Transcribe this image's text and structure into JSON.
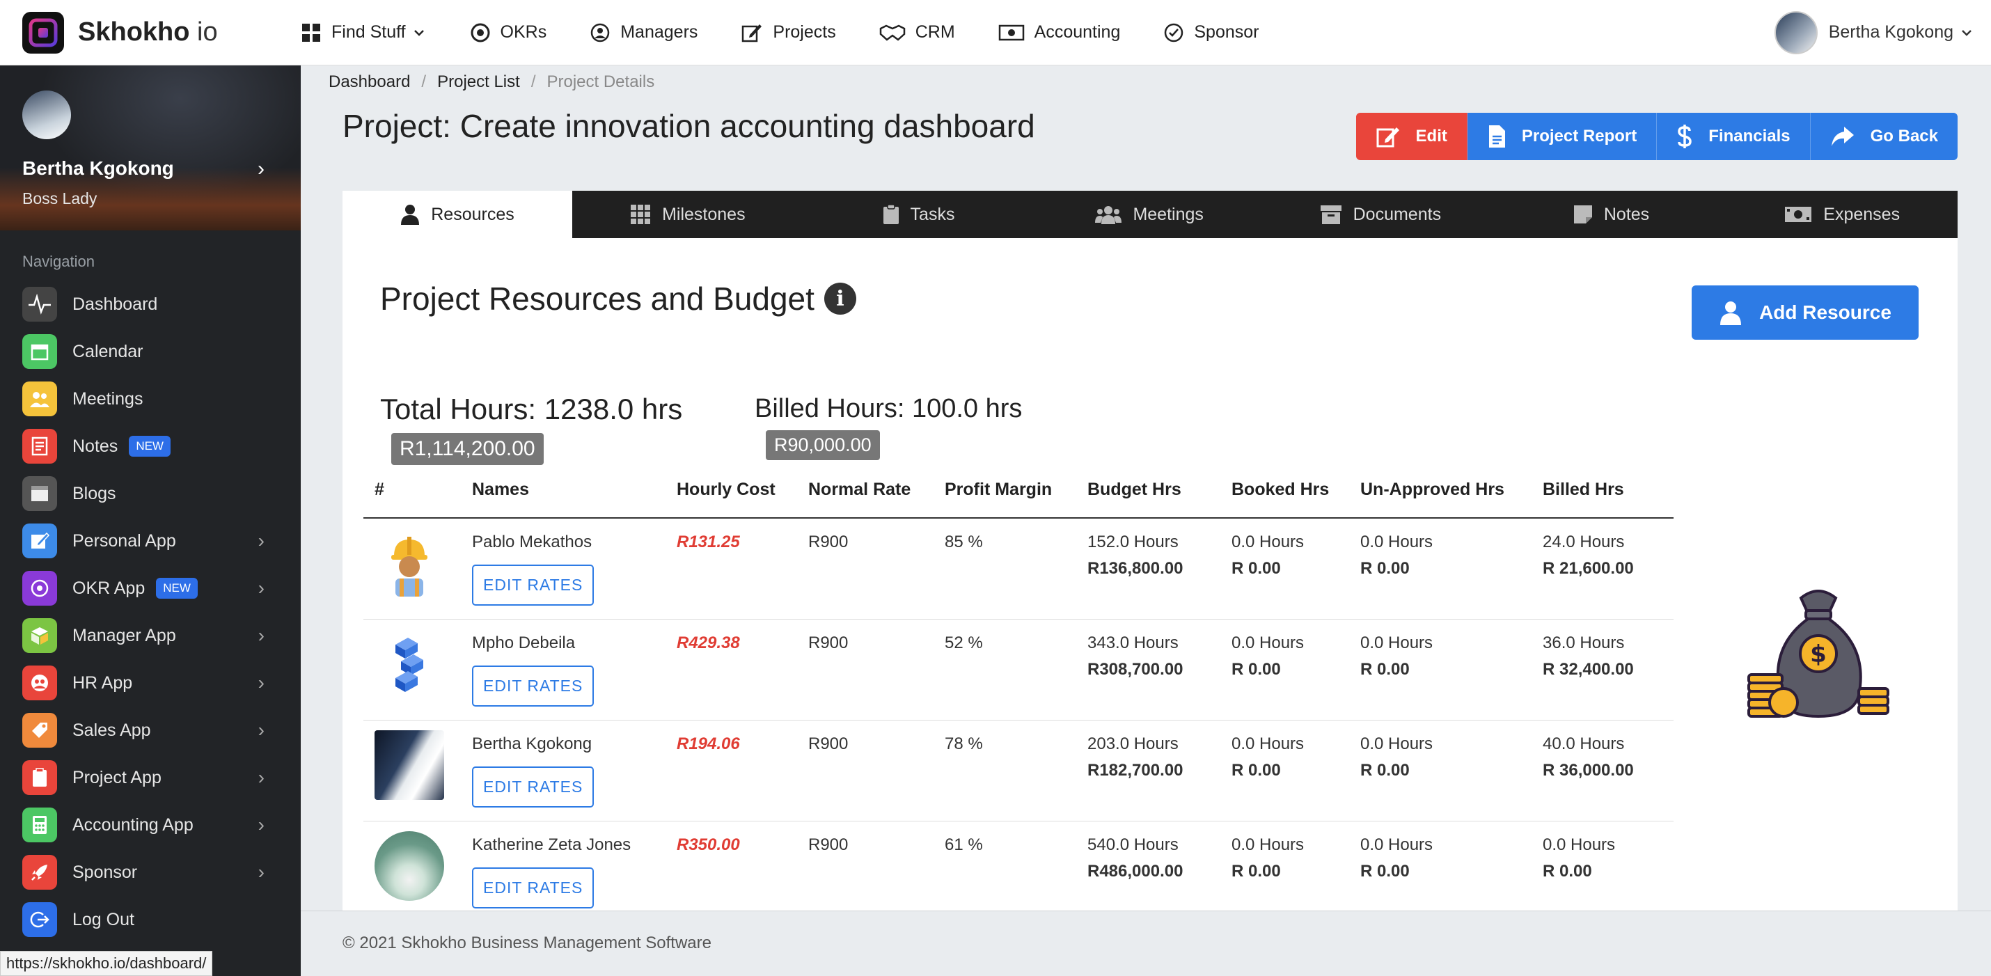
{
  "brand": {
    "name": "Skhokho",
    "suffix": " io"
  },
  "topnav": [
    {
      "label": "Find Stuff",
      "icon": "grid-icon"
    },
    {
      "label": "OKRs",
      "icon": "target-icon"
    },
    {
      "label": "Managers",
      "icon": "user-circle-icon"
    },
    {
      "label": "Projects",
      "icon": "edit-icon"
    },
    {
      "label": "CRM",
      "icon": "handshake-icon"
    },
    {
      "label": "Accounting",
      "icon": "money-icon"
    },
    {
      "label": "Sponsor",
      "icon": "check-circle-icon"
    }
  ],
  "user": {
    "name": "Bertha Kgokong",
    "role": "Boss Lady"
  },
  "sidebar": {
    "title": "Navigation",
    "items": [
      {
        "label": "Dashboard",
        "color": "#444444",
        "badge": "",
        "chevron": false
      },
      {
        "label": "Calendar",
        "color": "#4cc764",
        "badge": "",
        "chevron": false
      },
      {
        "label": "Meetings",
        "color": "#f5c33b",
        "badge": "",
        "chevron": false
      },
      {
        "label": "Notes",
        "color": "#e9453b",
        "badge": "NEW",
        "chevron": false
      },
      {
        "label": "Blogs",
        "color": "#555555",
        "badge": "",
        "chevron": false
      },
      {
        "label": "Personal App",
        "color": "#3d8be8",
        "badge": "",
        "chevron": true
      },
      {
        "label": "OKR App",
        "color": "#8a3ad8",
        "badge": "NEW",
        "chevron": true
      },
      {
        "label": "Manager App",
        "color": "#7cc543",
        "badge": "",
        "chevron": true
      },
      {
        "label": "HR App",
        "color": "#e9453b",
        "badge": "",
        "chevron": true
      },
      {
        "label": "Sales App",
        "color": "#f08a3c",
        "badge": "",
        "chevron": true
      },
      {
        "label": "Project App",
        "color": "#e9453b",
        "badge": "",
        "chevron": true
      },
      {
        "label": "Accounting App",
        "color": "#4cc764",
        "badge": "",
        "chevron": true
      },
      {
        "label": "Sponsor",
        "color": "#e9453b",
        "badge": "",
        "chevron": true
      },
      {
        "label": "Log Out",
        "color": "#2d6ee8",
        "badge": "",
        "chevron": false
      }
    ]
  },
  "status_url": "https://skhokho.io/dashboard/",
  "breadcrumb": [
    "Dashboard",
    "Project List",
    "Project Details"
  ],
  "page_title": "Project: Create innovation accounting dashboard",
  "actions": {
    "edit": "Edit",
    "report": "Project Report",
    "financials": "Financials",
    "back": "Go Back"
  },
  "tabs": [
    "Resources",
    "Milestones",
    "Tasks",
    "Meetings",
    "Documents",
    "Notes",
    "Expenses"
  ],
  "section_title": "Project Resources and Budget",
  "add_resource": "Add Resource",
  "totals": {
    "total_hours": "Total Hours: 1238.0 hrs",
    "total_amount": "R1,114,200.00",
    "billed_hours": "Billed Hours: 100.0 hrs",
    "billed_amount": "R90,000.00"
  },
  "table": {
    "headers": [
      "#",
      "Names",
      "Hourly Cost",
      "Normal Rate",
      "Profit Margin",
      "Budget Hrs",
      "Booked Hrs",
      "Un-Approved Hrs",
      "Billed Hrs"
    ],
    "edit_label": "EDIT RATES",
    "rows": [
      {
        "name": "Pablo Mekathos",
        "cost": "R131.25",
        "rate": "R900",
        "margin": "85 %",
        "budget_h": "152.0 Hours",
        "budget_r": "R136,800.00",
        "booked_h": "0.0 Hours",
        "booked_r": "R 0.00",
        "unapp_h": "0.0 Hours",
        "unapp_r": "R 0.00",
        "billed_h": "24.0 Hours",
        "billed_r": "R 21,600.00"
      },
      {
        "name": "Mpho Debeila",
        "cost": "R429.38",
        "rate": "R900",
        "margin": "52 %",
        "budget_h": "343.0 Hours",
        "budget_r": "R308,700.00",
        "booked_h": "0.0 Hours",
        "booked_r": "R 0.00",
        "unapp_h": "0.0 Hours",
        "unapp_r": "R 0.00",
        "billed_h": "36.0 Hours",
        "billed_r": "R 32,400.00"
      },
      {
        "name": "Bertha Kgokong",
        "cost": "R194.06",
        "rate": "R900",
        "margin": "78 %",
        "budget_h": "203.0 Hours",
        "budget_r": "R182,700.00",
        "booked_h": "0.0 Hours",
        "booked_r": "R 0.00",
        "unapp_h": "0.0 Hours",
        "unapp_r": "R 0.00",
        "billed_h": "40.0 Hours",
        "billed_r": "R 36,000.00"
      },
      {
        "name": "Katherine Zeta Jones",
        "cost": "R350.00",
        "rate": "R900",
        "margin": "61 %",
        "budget_h": "540.0 Hours",
        "budget_r": "R486,000.00",
        "booked_h": "0.0 Hours",
        "booked_r": "R 0.00",
        "unapp_h": "0.0 Hours",
        "unapp_r": "R 0.00",
        "billed_h": "0.0 Hours",
        "billed_r": "R 0.00"
      }
    ]
  },
  "footer": "© 2021 Skhokho Business Management Software"
}
